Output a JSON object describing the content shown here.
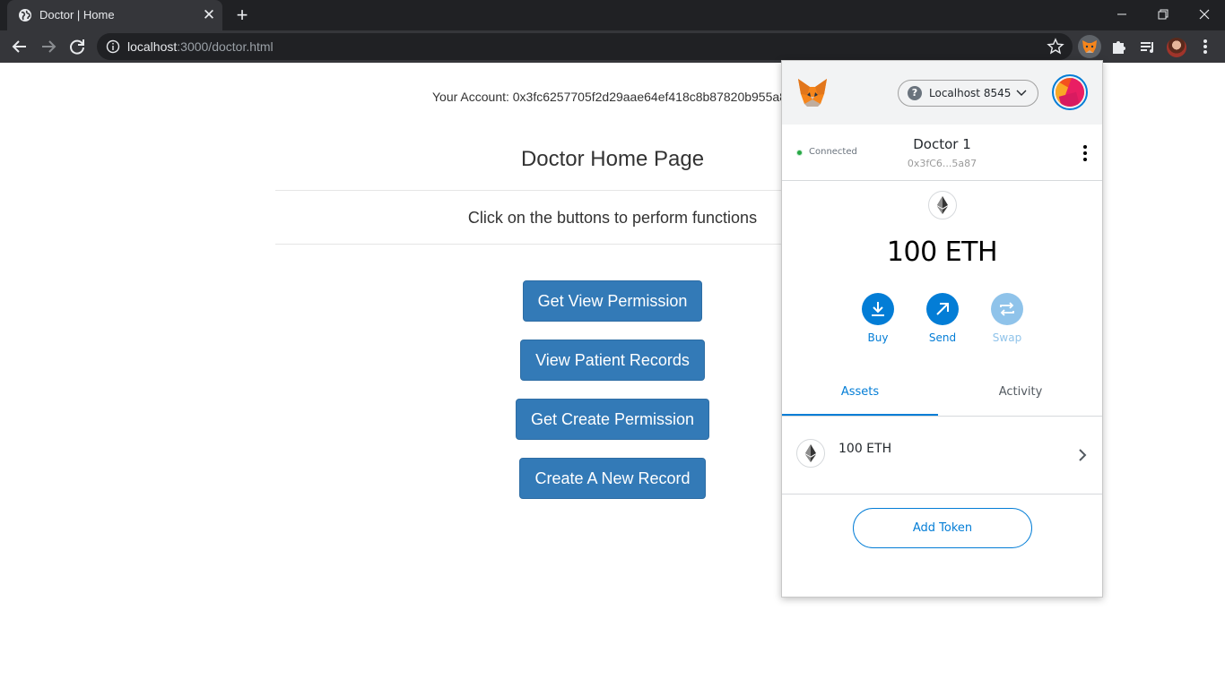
{
  "browser": {
    "tab_title": "Doctor | Home",
    "url_host": "localhost",
    "url_rest": ":3000/doctor.html"
  },
  "page": {
    "account_label": "Your Account: 0x3fc6257705f2d29aae64ef418c8b87820b955a8",
    "title": "Doctor Home Page",
    "subtitle": "Click on the buttons to perform functions",
    "buttons": [
      "Get View Permission",
      "View Patient Records",
      "Get Create Permission",
      "Create A New Record"
    ]
  },
  "metamask": {
    "network": "Localhost 8545",
    "connection_status": "Connected",
    "account_name": "Doctor 1",
    "account_address": "0x3fC6...5a87",
    "balance": "100 ETH",
    "actions": [
      "Buy",
      "Send",
      "Swap"
    ],
    "tabs": [
      "Assets",
      "Activity"
    ],
    "active_tab": "Assets",
    "asset_amount": "100 ETH",
    "add_token_label": "Add Token",
    "accent_color": "#037dd6"
  },
  "icons": {
    "tab": "globe-icon",
    "toolbar": [
      "back-arrow-icon",
      "forward-arrow-icon",
      "reload-icon",
      "info-icon",
      "star-icon",
      "metamask-fox-icon",
      "puzzle-icon",
      "reading-list-icon",
      "profile-avatar",
      "kebab-menu-icon"
    ]
  }
}
